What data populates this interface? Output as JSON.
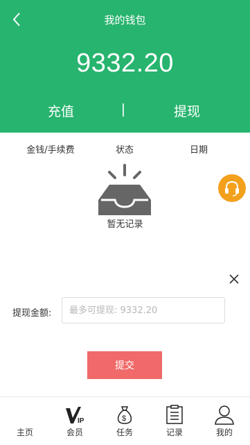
{
  "header": {
    "title": "我的钱包",
    "back_icon": "chevron-left-icon",
    "balance": "9332.20",
    "recharge_label": "充值",
    "separator": "|",
    "withdraw_label": "提现",
    "bg_color": "#27b46e"
  },
  "records": {
    "columns": [
      "金钱/手续费",
      "状态",
      "日期"
    ],
    "empty_text": "暂无记录",
    "empty_icon": "empty-inbox-icon"
  },
  "support": {
    "icon": "headset-icon",
    "color": "#f3a11c"
  },
  "withdraw_form": {
    "close_icon": "close-icon",
    "amount_label": "提现金额:",
    "amount_value": "",
    "amount_placeholder": "最多可提现: 9332.20",
    "submit_label": "提交",
    "submit_color": "#f06a6a"
  },
  "tabbar": {
    "items": [
      {
        "label": "主页",
        "icon": "home-icon"
      },
      {
        "label": "会员",
        "icon": "vip-icon"
      },
      {
        "label": "任务",
        "icon": "money-bag-icon"
      },
      {
        "label": "记录",
        "icon": "clipboard-icon"
      },
      {
        "label": "我的",
        "icon": "user-icon"
      }
    ]
  }
}
